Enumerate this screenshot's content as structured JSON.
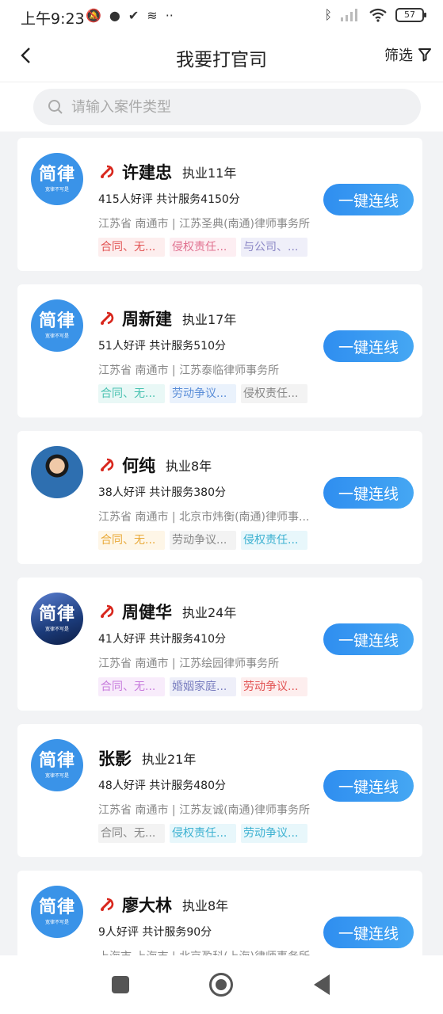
{
  "status_bar": {
    "time": "上午9:23",
    "left_icons": [
      "muted-bell-icon",
      "chat-icon",
      "check-icon",
      "layers-icon",
      "dots-icon"
    ],
    "battery": "57"
  },
  "header": {
    "title": "我要打官司",
    "filter_label": "筛选"
  },
  "search": {
    "placeholder": "请输入案件类型"
  },
  "avatar_text": {
    "main": "简律",
    "sub": "宽律不写是"
  },
  "lawyers": [
    {
      "name": "许建忠",
      "party_member": true,
      "years": "执业11年",
      "stats": "415人好评  共计服务4150分",
      "location": "江苏省  南通市 | 江苏圣典(南通)律师事务所",
      "avatar": "logo",
      "tags": [
        {
          "text": "合同、无...",
          "style": "red"
        },
        {
          "text": "侵权责任...",
          "style": "pink"
        },
        {
          "text": "与公司、...",
          "style": "purple"
        }
      ],
      "button": "一键连线"
    },
    {
      "name": "周新建",
      "party_member": true,
      "years": "执业17年",
      "stats": "51人好评  共计服务510分",
      "location": "江苏省  南通市 | 江苏泰临律师事务所",
      "avatar": "logo",
      "tags": [
        {
          "text": "合同、无...",
          "style": "teal"
        },
        {
          "text": "劳动争议...",
          "style": "blue"
        },
        {
          "text": "侵权责任...",
          "style": "gray"
        }
      ],
      "button": "一键连线"
    },
    {
      "name": "何纯",
      "party_member": true,
      "years": "执业8年",
      "stats": "38人好评  共计服务380分",
      "location": "江苏省  南通市 | 北京市炜衡(南通)律师事...",
      "avatar": "photo",
      "tags": [
        {
          "text": "合同、无...",
          "style": "orange"
        },
        {
          "text": "劳动争议...",
          "style": "gray"
        },
        {
          "text": "侵权责任...",
          "style": "cyan"
        }
      ],
      "button": "一键连线"
    },
    {
      "name": "周健华",
      "party_member": true,
      "years": "执业24年",
      "stats": "41人好评  共计服务410分",
      "location": "江苏省  南通市 | 江苏绘园律师事务所",
      "avatar": "tinted",
      "tags": [
        {
          "text": "合同、无...",
          "style": "magenta"
        },
        {
          "text": "婚姻家庭...",
          "style": "indigo"
        },
        {
          "text": "劳动争议...",
          "style": "red"
        }
      ],
      "button": "一键连线"
    },
    {
      "name": "张影",
      "party_member": false,
      "years": "执业21年",
      "stats": "48人好评  共计服务480分",
      "location": "江苏省  南通市 | 江苏友诚(南通)律师事务所",
      "avatar": "logo",
      "tags": [
        {
          "text": "合同、无...",
          "style": "gray"
        },
        {
          "text": "侵权责任...",
          "style": "cyan"
        },
        {
          "text": "劳动争议...",
          "style": "cyan"
        }
      ],
      "button": "一键连线"
    },
    {
      "name": "廖大林",
      "party_member": true,
      "years": "执业8年",
      "stats": "9人好评  共计服务90分",
      "location": "上海市  上海市 | 北京盈科(上海)律师事务所",
      "avatar": "logo",
      "tags": [],
      "button": "一键连线"
    }
  ]
}
